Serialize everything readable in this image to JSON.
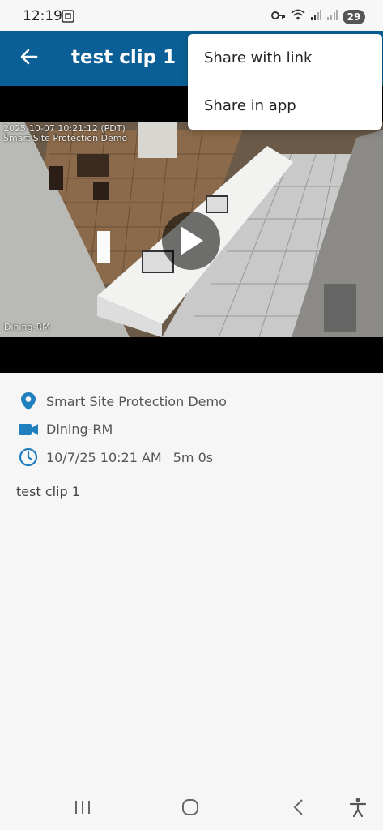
{
  "status_bar": {
    "time": "12:19",
    "battery": "29",
    "icons": [
      "screenshot-icon",
      "key-icon",
      "wifi-icon",
      "signal-icon",
      "signal-icon",
      "battery-icon"
    ]
  },
  "app_bar": {
    "title": "test clip 1",
    "back_icon": "arrow-left-icon",
    "color": "#0a5f96"
  },
  "video": {
    "timestamp": "2025-10-07 10:21:12 (PDT)",
    "site_overlay": "Smart Site Protection Demo",
    "camera_overlay": "Dining-RM",
    "play_icon": "play-icon"
  },
  "menu": {
    "items": [
      {
        "label": "Share with link"
      },
      {
        "label": "Share in app"
      }
    ]
  },
  "details": {
    "site": "Smart Site Protection Demo",
    "camera": "Dining-RM",
    "datetime": "10/7/25 10:21 AM",
    "duration": "5m 0s",
    "icon_color": "#1f7fbf"
  },
  "clip_name": "test clip 1",
  "nav_bar": {
    "icons": [
      "recent-apps-icon",
      "home-icon",
      "back-icon",
      "accessibility-icon"
    ]
  }
}
